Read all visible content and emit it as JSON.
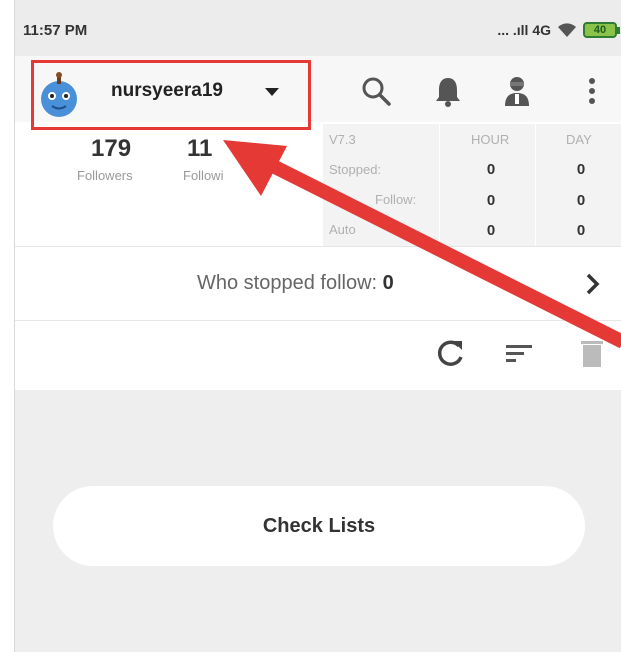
{
  "status_bar": {
    "time": "11:57 PM",
    "signal_text": "... .ıll 4G",
    "battery": "40"
  },
  "header": {
    "username": "nursyeera19",
    "icons": [
      "search-icon",
      "bell-icon",
      "user-agent-icon",
      "more-vert-icon"
    ]
  },
  "stats": {
    "followers_count": "179",
    "followers_label": "Followers",
    "following_count": "11",
    "following_label": "Followi"
  },
  "table": {
    "version": "V7.3",
    "col_hour": "HOUR",
    "col_day": "DAY",
    "rows": [
      {
        "label": "Stopped:",
        "hour": "0",
        "day": "0"
      },
      {
        "label": "Follow:",
        "hour": "0",
        "day": "0"
      },
      {
        "label": "Auto",
        "hour": "0",
        "day": "0"
      }
    ]
  },
  "who_stopped": {
    "label": "Who stopped follow:",
    "count": "0"
  },
  "toolbar": {
    "icons": [
      "refresh-icon",
      "sort-icon",
      "trash-icon"
    ]
  },
  "main": {
    "check_lists_label": "Check Lists"
  },
  "colors": {
    "annotation_red": "#e53935",
    "avatar_blue": "#4a90d9"
  }
}
